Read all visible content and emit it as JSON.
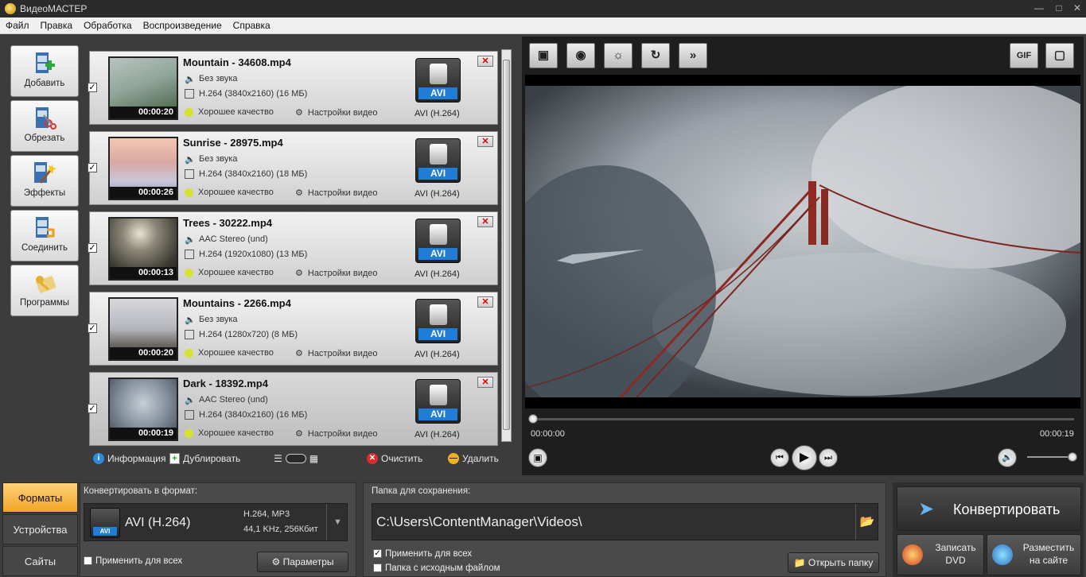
{
  "window": {
    "title": "ВидеоМАСТЕР",
    "controls": [
      "minimize",
      "maximize",
      "close"
    ]
  },
  "menu": [
    "Файл",
    "Правка",
    "Обработка",
    "Воспроизведение",
    "Справка"
  ],
  "sidebar": [
    {
      "label": "Добавить",
      "icon": "add-film-icon"
    },
    {
      "label": "Обрезать",
      "icon": "scissors-film-icon"
    },
    {
      "label": "Эффекты",
      "icon": "magic-wand-icon"
    },
    {
      "label": "Соединить",
      "icon": "join-film-icon"
    },
    {
      "label": "Программы",
      "icon": "key-card-icon"
    }
  ],
  "files": [
    {
      "name": "Mountain - 34608.mp4",
      "duration": "00:00:20",
      "audio": "Без звука",
      "video": "H.264 (3840x2160) (16 МБ)",
      "quality": "Хорошее качество",
      "settings": "Настройки видео",
      "format": "AVI",
      "format_text": "AVI (H.264)",
      "checked": true
    },
    {
      "name": "Sunrise - 28975.mp4",
      "duration": "00:00:26",
      "audio": "Без звука",
      "video": "H.264 (3840x2160) (18 МБ)",
      "quality": "Хорошее качество",
      "settings": "Настройки видео",
      "format": "AVI",
      "format_text": "AVI (H.264)",
      "checked": true
    },
    {
      "name": "Trees - 30222.mp4",
      "duration": "00:00:13",
      "audio": "AAC Stereo (und)",
      "video": "H.264 (1920x1080) (13 МБ)",
      "quality": "Хорошее качество",
      "settings": "Настройки видео",
      "format": "AVI",
      "format_text": "AVI (H.264)",
      "checked": true
    },
    {
      "name": "Mountains - 2266.mp4",
      "duration": "00:00:20",
      "audio": "Без звука",
      "video": "H.264 (1280x720) (8 МБ)",
      "quality": "Хорошее качество",
      "settings": "Настройки видео",
      "format": "AVI",
      "format_text": "AVI (H.264)",
      "checked": true
    },
    {
      "name": "Dark - 18392.mp4",
      "duration": "00:00:19",
      "audio": "AAC Stereo (und)",
      "video": "H.264 (3840x2160) (16 МБ)",
      "quality": "Хорошее качество",
      "settings": "Настройки видео",
      "format": "AVI",
      "format_text": "AVI (H.264)",
      "checked": true,
      "selected": true
    }
  ],
  "list_toolbar": {
    "info": "Информация",
    "duplicate": "Дублировать",
    "clear": "Очистить",
    "delete": "Удалить"
  },
  "preview": {
    "toolbar": [
      "crop-icon",
      "watermark-icon",
      "brightness-icon",
      "rotate-icon",
      "speed-icon"
    ],
    "gif": "GIF",
    "time_current": "00:00:00",
    "time_total": "00:00:19",
    "progress": 0,
    "volume": 1.0
  },
  "bottom": {
    "tabs": [
      "Форматы",
      "Устройства",
      "Сайты"
    ],
    "active_tab": "Форматы",
    "convert_label": "Конвертировать в формат:",
    "format_name": "AVI (H.264)",
    "format_badge": "AVI",
    "codec_line1": "H.264, MP3",
    "codec_line2": "44,1 KHz, 256Кбит",
    "apply_all": "Применить для всех",
    "params": "Параметры",
    "folder_label": "Папка для сохранения:",
    "folder_path": "C:\\Users\\ContentManager\\Videos\\",
    "apply_all2": "Применить для всех",
    "source_folder": "Папка с исходным файлом",
    "open_folder": "Открыть папку",
    "convert": "Конвертировать",
    "dvd_line1": "Записать",
    "dvd_line2": "DVD",
    "web_line1": "Разместить",
    "web_line2": "на сайте"
  },
  "colors": {
    "accent": "#f3a526",
    "avi_blue": "#1f7dd6"
  }
}
